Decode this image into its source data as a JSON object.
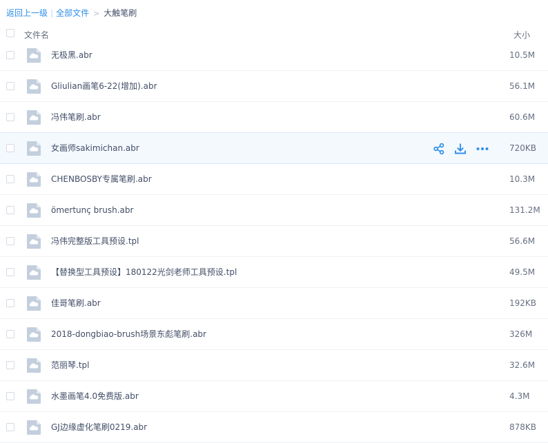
{
  "breadcrumb": {
    "back_label": "返回上一级",
    "all_files_label": "全部文件",
    "current_folder": "大触笔刷"
  },
  "header": {
    "name_label": "文件名",
    "size_label": "大小"
  },
  "colors": {
    "accent": "#2e8ee8",
    "icon_fill": "#c3cfdd",
    "hover_bg": "#f4f9fe"
  },
  "files": [
    {
      "name": "无极黑.abr",
      "size": "10.5M"
    },
    {
      "name": "Gliulian画笔6-22(增加).abr",
      "size": "56.1M"
    },
    {
      "name": "冯伟笔刷.abr",
      "size": "60.6M"
    },
    {
      "name": "女画师sakimichan.abr",
      "size": "720KB"
    },
    {
      "name": "CHENBOSBY专属笔刷.abr",
      "size": "10.3M"
    },
    {
      "name": "ömertunç brush.abr",
      "size": "131.2M"
    },
    {
      "name": "冯伟完整版工具预设.tpl",
      "size": "56.6M"
    },
    {
      "name": "【替换型工具预设】180122光剑老师工具预设.tpl",
      "size": "49.5M"
    },
    {
      "name": "佳哥笔刷.abr",
      "size": "192KB"
    },
    {
      "name": "2018-dongbiao-brush场景东彪笔刷.abr",
      "size": "326M"
    },
    {
      "name": "范丽琴.tpl",
      "size": "32.6M"
    },
    {
      "name": "水墨画笔4.0免费版.abr",
      "size": "4.3M"
    },
    {
      "name": "GJ边缘虚化笔刷0219.abr",
      "size": "878KB"
    }
  ],
  "hover_row_index": 3,
  "row_actions": [
    {
      "icon": "share-icon"
    },
    {
      "icon": "download-icon"
    },
    {
      "icon": "more-icon"
    }
  ]
}
